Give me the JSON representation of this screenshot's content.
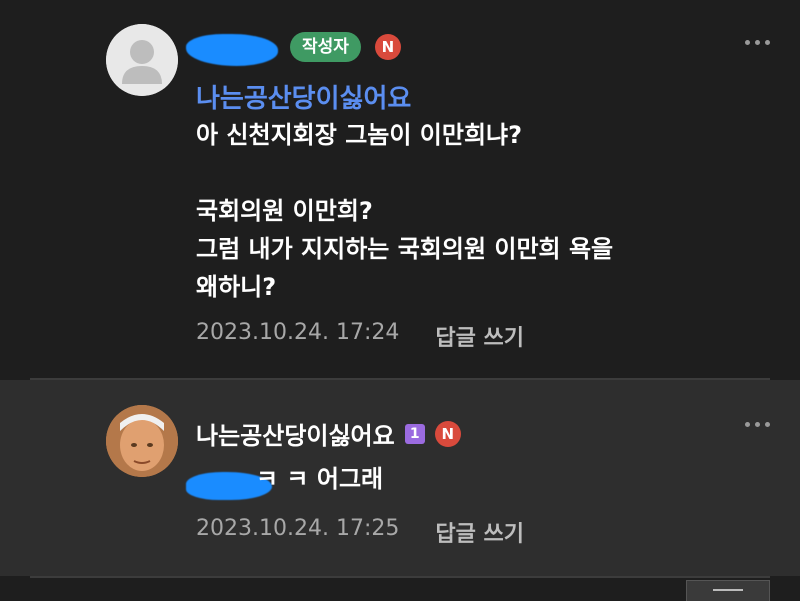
{
  "comments": [
    {
      "author_badge": "작성자",
      "new_badge": "N",
      "reply_to": "나는공산당이싫어요",
      "body": [
        "아 신천지회장 그놈이 이만희냐?",
        "",
        "국회의원 이만희?",
        "그럼 내가 지지하는 국회의원 이만희 욕을",
        "왜하니?"
      ],
      "timestamp": "2023.10.24. 17:24",
      "reply_label": "답글 쓰기"
    },
    {
      "author": "나는공산당이싫어요",
      "level_badge": "1",
      "new_badge": "N",
      "body": "ㅋ ㅋ 어그래",
      "timestamp": "2023.10.24. 17:25",
      "reply_label": "답글 쓰기"
    }
  ],
  "colors": {
    "background": "#1e1e1e",
    "reply_background": "#2e2e2e",
    "mention": "#5b8ef0",
    "author_badge": "#3f9a63",
    "new_badge": "#d94a3c",
    "redaction": "#1a8cff"
  },
  "icons": [
    "default-avatar-icon",
    "more-options-icon"
  ]
}
